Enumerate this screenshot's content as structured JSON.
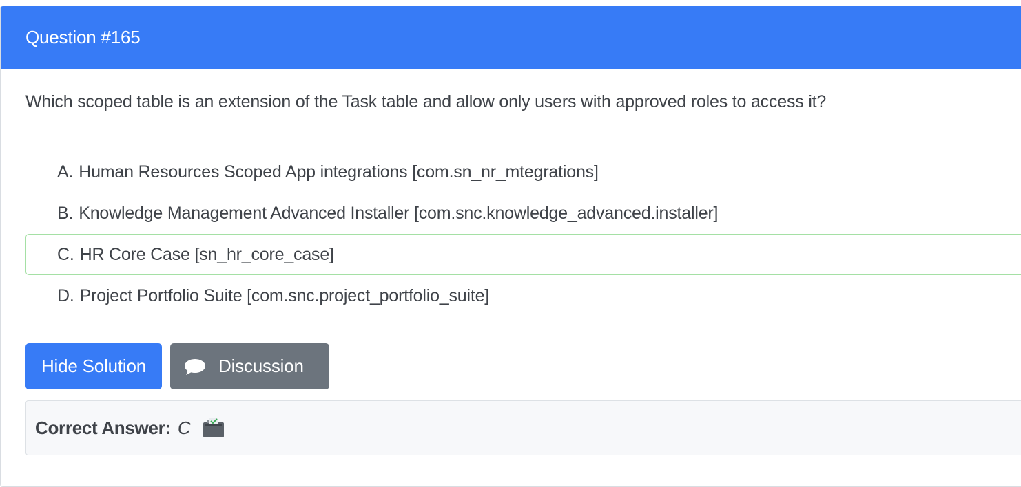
{
  "header": {
    "title": "Question #165"
  },
  "question": {
    "text": "Which scoped table is an extension of the Task table and allow only users with approved roles to access it?"
  },
  "choices": [
    {
      "letter": "A.",
      "text": "Human Resources Scoped App integrations [com.sn_nr_mtegrations]",
      "correct": false
    },
    {
      "letter": "B.",
      "text": "Knowledge Management Advanced Installer [com.snc.knowledge_advanced.installer]",
      "correct": false
    },
    {
      "letter": "C.",
      "text": "HR Core Case [sn_hr_core_case]",
      "correct": true
    },
    {
      "letter": "D.",
      "text": "Project Portfolio Suite [com.snc.project_portfolio_suite]",
      "correct": false
    }
  ],
  "buttons": {
    "hide_solution": "Hide Solution",
    "discussion": "Discussion"
  },
  "answer": {
    "label": "Correct Answer:",
    "value": "C"
  },
  "icons": {
    "discussion": "speech-bubble-icon",
    "vote": "ballot-box-icon"
  },
  "colors": {
    "primary": "#377bf6",
    "secondary": "#6c747d",
    "correct_border": "#a5e0a5"
  }
}
